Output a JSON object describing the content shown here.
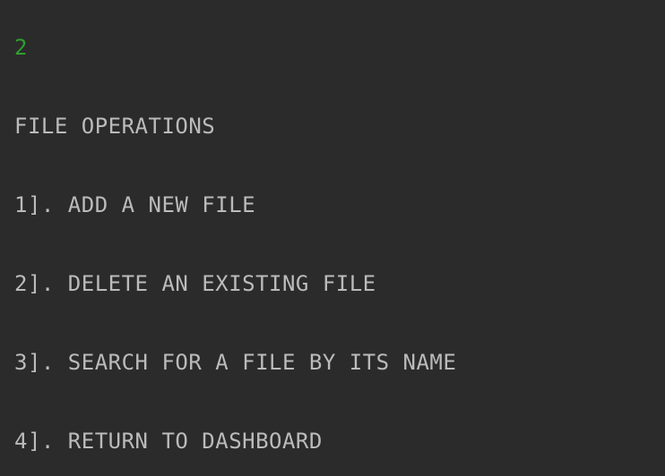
{
  "console": {
    "input_echo": "2",
    "menu_title": "FILE OPERATIONS",
    "options": [
      "1]. ADD A NEW FILE",
      "2]. DELETE AN EXISTING FILE",
      "3]. SEARCH FOR A FILE BY ITS NAME",
      "4]. RETURN TO DASHBOARD"
    ]
  },
  "colors": {
    "background": "#2b2b2b",
    "text": "#bbbbbb",
    "input": "#2f9e2f"
  }
}
